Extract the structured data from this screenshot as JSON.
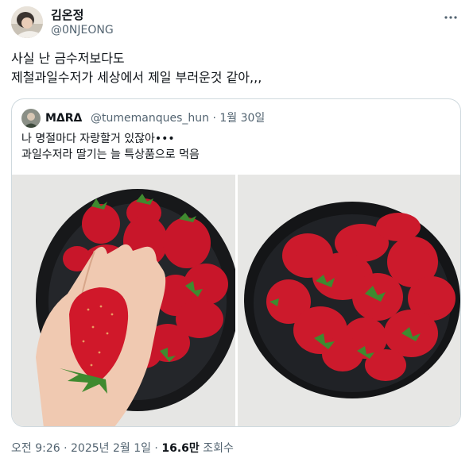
{
  "author": {
    "display_name": "김온정",
    "handle": "@0NJEONG",
    "avatar_icon": "profile-photo"
  },
  "tweet": {
    "lines": [
      "사실 난 금수저보다도",
      "제철과일수저가 세상에서 제일 부러운것 같아,,,"
    ]
  },
  "quoted": {
    "display_name": "MΔRΔ",
    "handle_date": "@tumemanques_hun · 1월 30일",
    "lines": [
      "나 명절마다 자랑할거 있잖아•••",
      "과일수저라 딸기는 늘 특상품으로 먹음"
    ],
    "media": [
      {
        "alt_icon": "strawberry-photo-hand"
      },
      {
        "alt_icon": "strawberry-photo-bowl"
      }
    ]
  },
  "meta": {
    "time_date": "오전 9:26 · 2025년 2월 1일 · ",
    "views_count": "16.6만",
    "views_label": " 조회수"
  },
  "colors": {
    "text_primary": "#0f1419",
    "text_secondary": "#536471",
    "border": "#cfd9de",
    "strawberry": "#d0182a"
  },
  "icons": {
    "more": "more-horizontal-icon"
  }
}
